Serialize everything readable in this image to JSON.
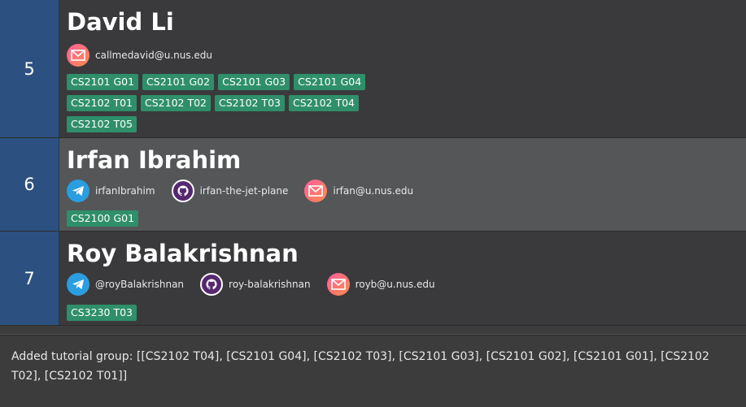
{
  "persons": [
    {
      "index": "5",
      "name": "David Li",
      "contacts": [
        {
          "type": "email",
          "icon": "email-icon",
          "text": "callmedavid@u.nus.edu"
        }
      ],
      "tags": [
        "CS2101 G01",
        "CS2101 G02",
        "CS2101 G03",
        "CS2101 G04",
        "CS2102 T01",
        "CS2102 T02",
        "CS2102 T03",
        "CS2102 T04",
        "CS2102 T05"
      ]
    },
    {
      "index": "6",
      "name": "Irfan Ibrahim",
      "contacts": [
        {
          "type": "telegram",
          "icon": "telegram-icon",
          "text": "irfanIbrahim"
        },
        {
          "type": "github",
          "icon": "github-icon",
          "text": "irfan-the-jet-plane"
        },
        {
          "type": "email",
          "icon": "email-icon",
          "text": "irfan@u.nus.edu"
        }
      ],
      "tags": [
        "CS2100 G01"
      ]
    },
    {
      "index": "7",
      "name": "Roy Balakrishnan",
      "contacts": [
        {
          "type": "telegram",
          "icon": "telegram-icon",
          "text": "@royBalakrishnan"
        },
        {
          "type": "github",
          "icon": "github-icon",
          "text": "roy-balakrishnan"
        },
        {
          "type": "email",
          "icon": "email-icon",
          "text": "royb@u.nus.edu"
        }
      ],
      "tags": [
        "CS3230 T03"
      ]
    }
  ],
  "result_display": {
    "text": "Added tutorial group: [[CS2102 T04], [CS2101 G04], [CS2102 T03], [CS2101 G03], [CS2101 G02], [CS2101 G01], [CS2102 T02], [CS2102 T01]]"
  },
  "colors": {
    "index_bg": "#2c5180",
    "tag_bg": "#2f8f6b",
    "selected_card_bg": "#545658"
  }
}
